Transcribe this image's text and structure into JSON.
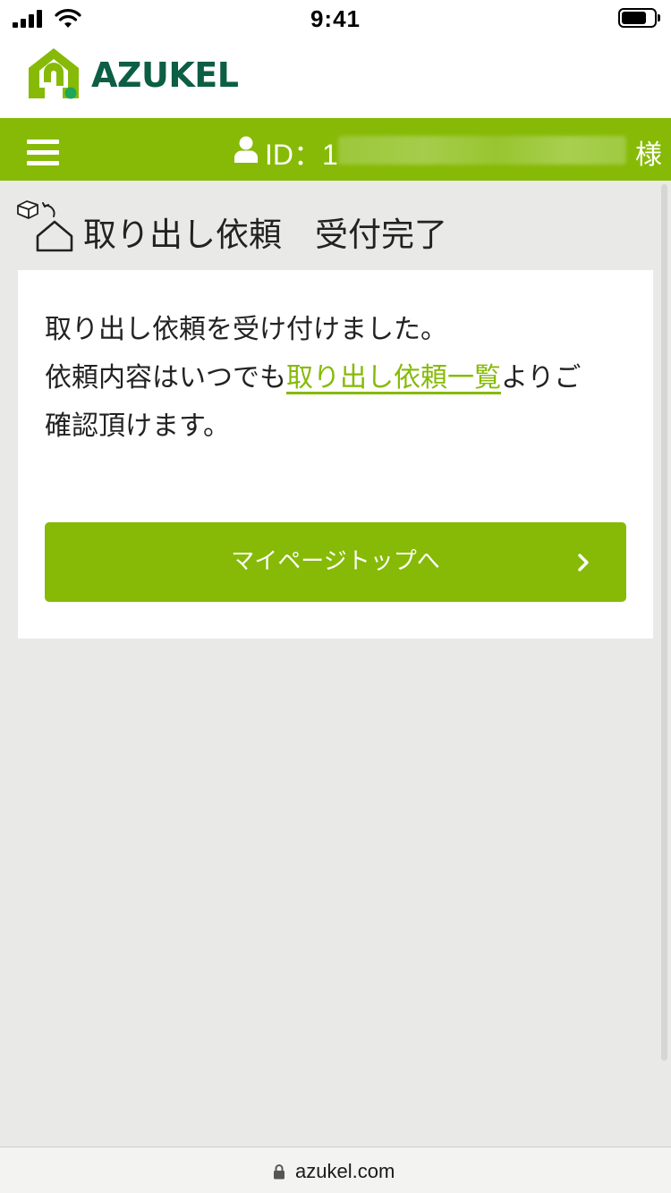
{
  "status_bar": {
    "time": "9:41"
  },
  "header": {
    "brand_name": "AZUKEL",
    "brand_color": "#0c5e44",
    "accent_color": "#86ba07"
  },
  "navbar": {
    "menu_icon": "hamburger-icon",
    "user_icon": "user-icon",
    "id_label": "ID：1",
    "honorific": "様"
  },
  "page": {
    "title_icon": "box-return-house-icon",
    "title": "取り出し依頼　受付完了"
  },
  "message": {
    "line1": "取り出し依頼を受け付けました。",
    "line2_before_link": "依頼内容はいつでも",
    "link_text": "取り出し依頼一覧",
    "line2_after_link": "よりご",
    "line3": "確認頂けます。"
  },
  "cta": {
    "label": "マイページトップへ",
    "icon": "chevron-right-icon"
  },
  "browser": {
    "lock_icon": "lock-icon",
    "url": "azukel.com"
  }
}
